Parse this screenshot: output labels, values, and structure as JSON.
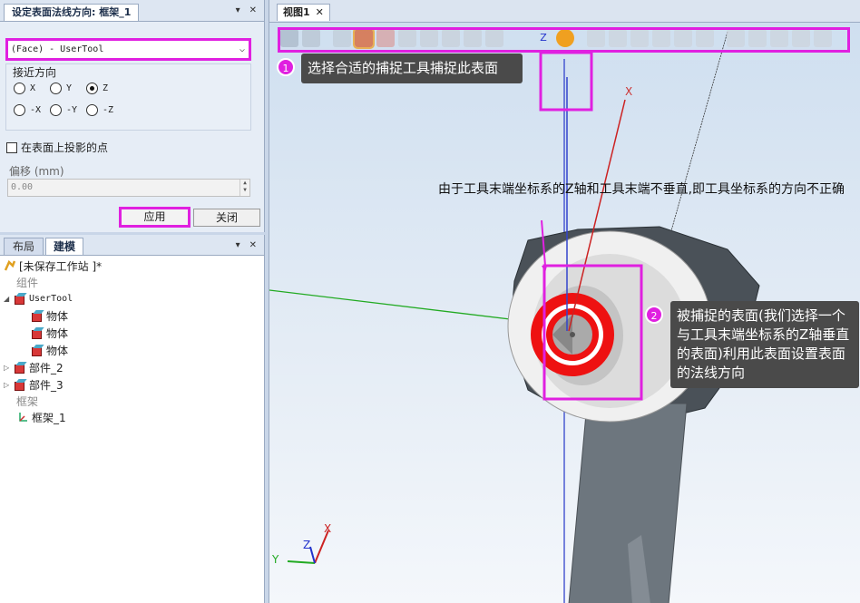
{
  "top_panel": {
    "title": "设定表面法线方向: 框架_1",
    "pin": "▾",
    "close": "✕",
    "face_select": "(Face) - UserTool",
    "approach_label": "接近方向",
    "radios": [
      "X",
      "Y",
      "Z",
      "-X",
      "-Y",
      "-Z"
    ],
    "selected_radio": "Z",
    "project_label": "在表面上投影的点",
    "offset_label": "偏移 (mm)",
    "offset_value": "0.00",
    "apply_label": "应用",
    "close_label": "关闭"
  },
  "bottom_panel": {
    "tab_layout": "布局",
    "tab_modeling": "建模",
    "station": "[未保存工作站 ]*",
    "components": "组件",
    "usertool": "UserTool",
    "bodies": [
      "物体",
      "物体",
      "物体"
    ],
    "parts": [
      "部件_2",
      "部件_3"
    ],
    "frames": "框架",
    "frame_item": "框架_1"
  },
  "view": {
    "tab": "视图1",
    "tab_close": "✕",
    "callout1": "选择合适的捕捉工具捕捉此表面",
    "badge1": "1",
    "callout2": "被捕捉的表面(我们选择一个与工具末端坐标系的Z轴垂直的表面)利用此表面设置表面的法线方向",
    "badge2": "2",
    "note": "由于工具末端坐标系的Z轴和工具末端不垂直,即工具坐标系的方向不正确",
    "axis_labels": {
      "x": "X",
      "y": "Y",
      "z": "Z"
    },
    "tool_z": "Z",
    "tool_x": "X"
  },
  "colors": {
    "highlight": "#e020e0",
    "callout_bg": "#4a4a4a"
  }
}
